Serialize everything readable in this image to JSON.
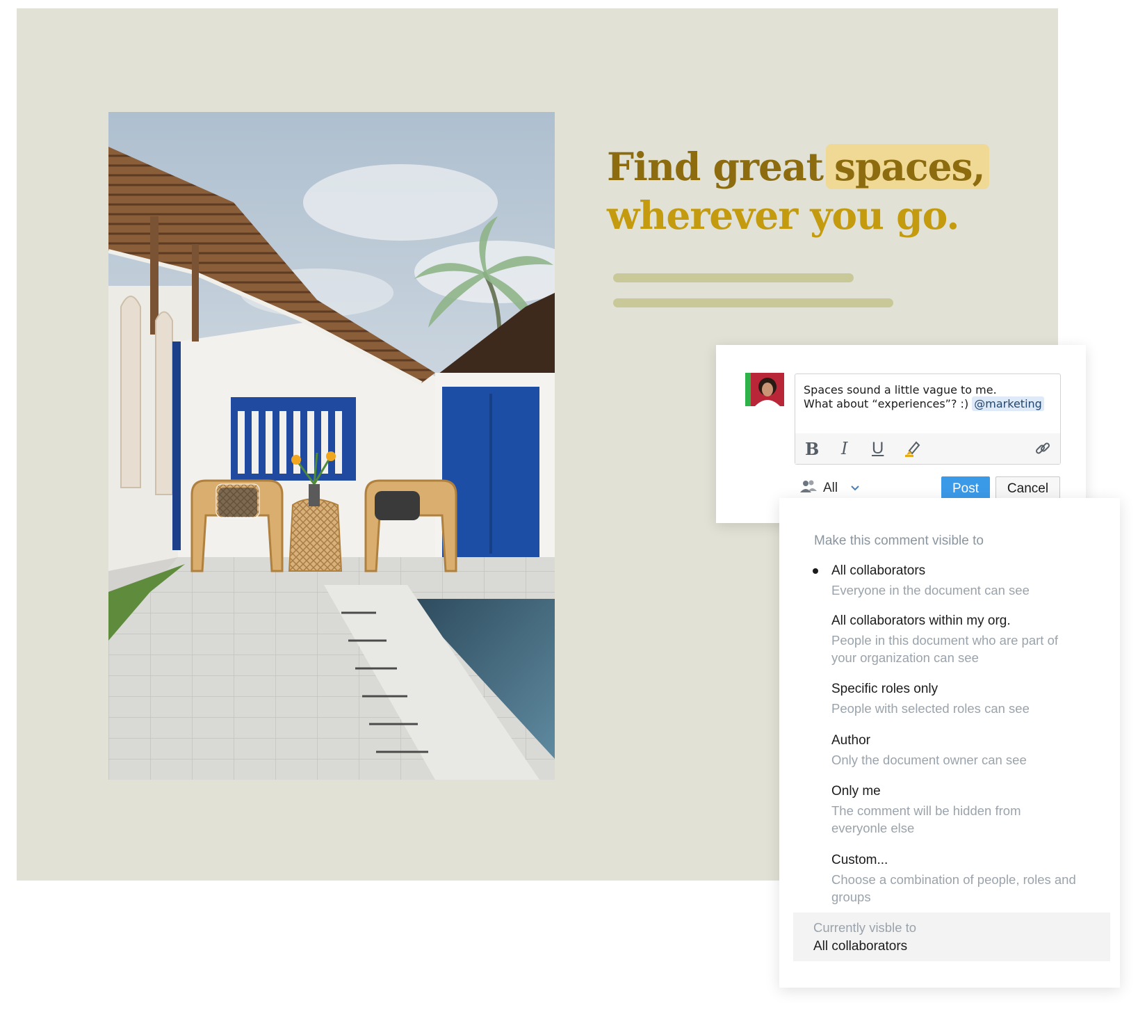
{
  "headline": {
    "line1_prefix": "Find great",
    "line1_highlight": "spaces,",
    "line2": "wherever you go."
  },
  "comment": {
    "text_line1": "Spaces sound a little vague to me.",
    "text_line2": "What about “experiences”? :)",
    "mention": "@marketing",
    "toolbar": {
      "bold": "B",
      "italic": "I",
      "underline": "U"
    },
    "visibility_value": "All",
    "post_label": "Post",
    "cancel_label": "Cancel"
  },
  "visibility_menu": {
    "heading": "Make this comment visible to",
    "options": [
      {
        "title": "All collaborators",
        "desc": "Everyone in the document can see",
        "selected": true
      },
      {
        "title": "All collaborators within my org.",
        "desc": "People in this document who are part of your organization can see",
        "selected": false
      },
      {
        "title": "Specific roles only",
        "desc": "People with selected roles can see",
        "selected": false
      },
      {
        "title": "Author",
        "desc": "Only the document owner can see",
        "selected": false
      },
      {
        "title": "Only me",
        "desc": "The comment will be hidden from everyonle else",
        "selected": false
      },
      {
        "title": "Custom...",
        "desc": "Choose a combination of people, roles and groups",
        "selected": false
      }
    ],
    "current_label": "Currently visble to",
    "current_value": "All collaborators"
  },
  "colors": {
    "accent_blue": "#3b9ae8",
    "headline_dark": "#8c6c0e",
    "headline_gold": "#c49b0e",
    "highlight": "#efd994",
    "doc_background": "#e1e1d5"
  },
  "icons": [
    "bold-icon",
    "italic-icon",
    "underline-icon",
    "highlighter-icon",
    "link-icon",
    "group-icon",
    "chevron-down-icon"
  ]
}
